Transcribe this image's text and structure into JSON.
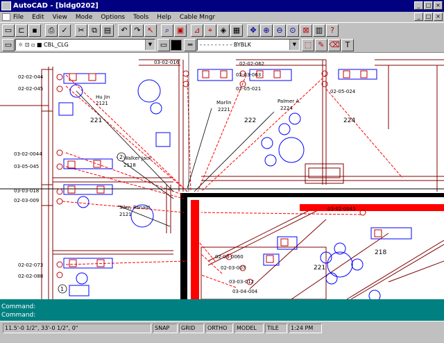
{
  "window": {
    "title": "AutoCAD - [bldg0202]"
  },
  "menubar": {
    "items": [
      "File",
      "Edit",
      "View",
      "Mode",
      "Options",
      "Tools",
      "Help",
      "Cable Mngr"
    ]
  },
  "layer_bar": {
    "layer_value": "CBL_CLG",
    "linetype_value": "- - - - - - - - - BYBLK"
  },
  "drawing": {
    "room_numbers": [
      "221",
      "222",
      "224",
      "218",
      "221"
    ],
    "occupants": [
      {
        "name": "Hu Jin",
        "room": "2121"
      },
      {
        "name": "Marlin",
        "room": "2221"
      },
      {
        "name": "Palmer A.",
        "room": "2224"
      },
      {
        "name": "Walker Jack",
        "room": "2118"
      },
      {
        "name": "Siler, Ronald",
        "room": "2121"
      }
    ],
    "callout_numbers": [
      "2",
      "1"
    ],
    "port_labels": [
      "02-02-044",
      "02-02-045",
      "02-02-062",
      "02-03-063",
      "02-05-021",
      "02-05-024",
      "03-02-0044",
      "03-05-045",
      "03-03-018",
      "02-03-009",
      "03-02-0045",
      "02-03-0060",
      "02-03-007",
      "03-03-012",
      "03-04-004",
      "02-02-073",
      "02-02-088",
      "03-02-016"
    ],
    "colors": {
      "cable": "#ff0000",
      "furniture": "#0000ff",
      "walls": "#800000",
      "leaders": "#000000"
    }
  },
  "command": {
    "line1": "Command:",
    "line2": "Command:"
  },
  "status": {
    "coords": "11.5'-0 1/2\", 33'-0 1/2\", 0\"",
    "snap": "SNAP",
    "grid": "GRID",
    "ortho": "ORTHO",
    "model": "MODEL",
    "tile": "TILE",
    "time": "1:24 PM"
  }
}
